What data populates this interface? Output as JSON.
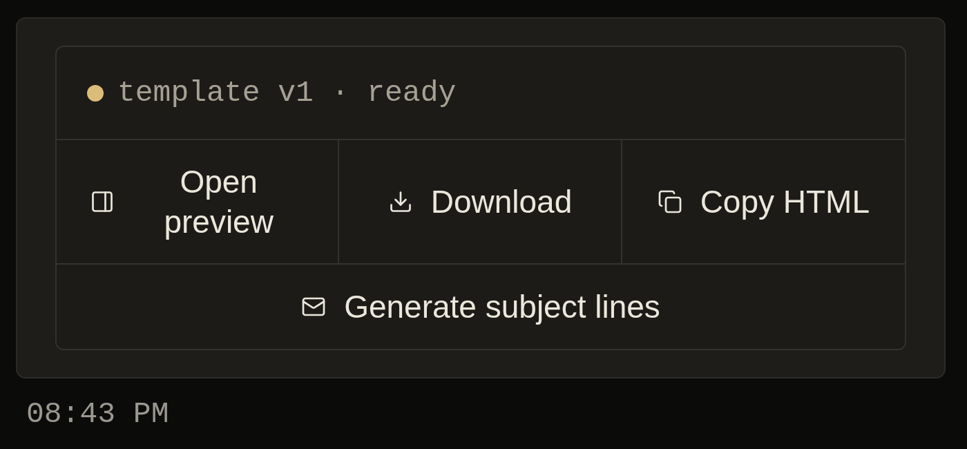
{
  "status": {
    "text": "template v1 · ready"
  },
  "actions": [
    {
      "kind": "preview",
      "label": "Open preview"
    },
    {
      "kind": "download",
      "label": "Download"
    },
    {
      "kind": "copy",
      "label": "Copy HTML"
    }
  ],
  "footer_action": {
    "kind": "mail",
    "label": "Generate subject lines"
  },
  "timestamp": "08:43 PM"
}
